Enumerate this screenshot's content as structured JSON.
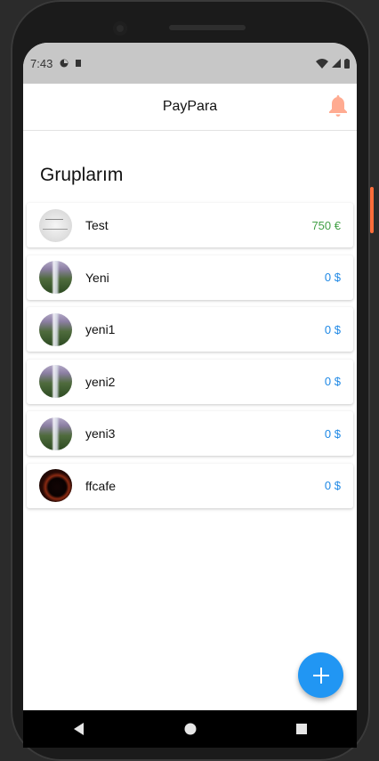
{
  "status_bar": {
    "time": "7:43"
  },
  "app_bar": {
    "title": "PayPara",
    "bell_color": "#ffab91"
  },
  "page": {
    "title": "Gruplarım"
  },
  "groups": [
    {
      "name": "Test",
      "amount": "750 €",
      "amount_color": "green",
      "avatar": "test-icon"
    },
    {
      "name": "Yeni",
      "amount": "0 $",
      "amount_color": "blue",
      "avatar": "waterfall-image"
    },
    {
      "name": "yeni1",
      "amount": "0 $",
      "amount_color": "blue",
      "avatar": "waterfall-image"
    },
    {
      "name": "yeni2",
      "amount": "0 $",
      "amount_color": "blue",
      "avatar": "waterfall-image"
    },
    {
      "name": "yeni3",
      "amount": "0 $",
      "amount_color": "blue",
      "avatar": "waterfall-image"
    },
    {
      "name": "ffcafe",
      "amount": "0 $",
      "amount_color": "blue",
      "avatar": "eclipse-image"
    }
  ],
  "fab": {
    "icon": "plus-icon",
    "color": "#2196f3"
  },
  "colors": {
    "accent": "#2196f3",
    "positive": "#43a047",
    "statusbar": "#c7c7c7"
  }
}
